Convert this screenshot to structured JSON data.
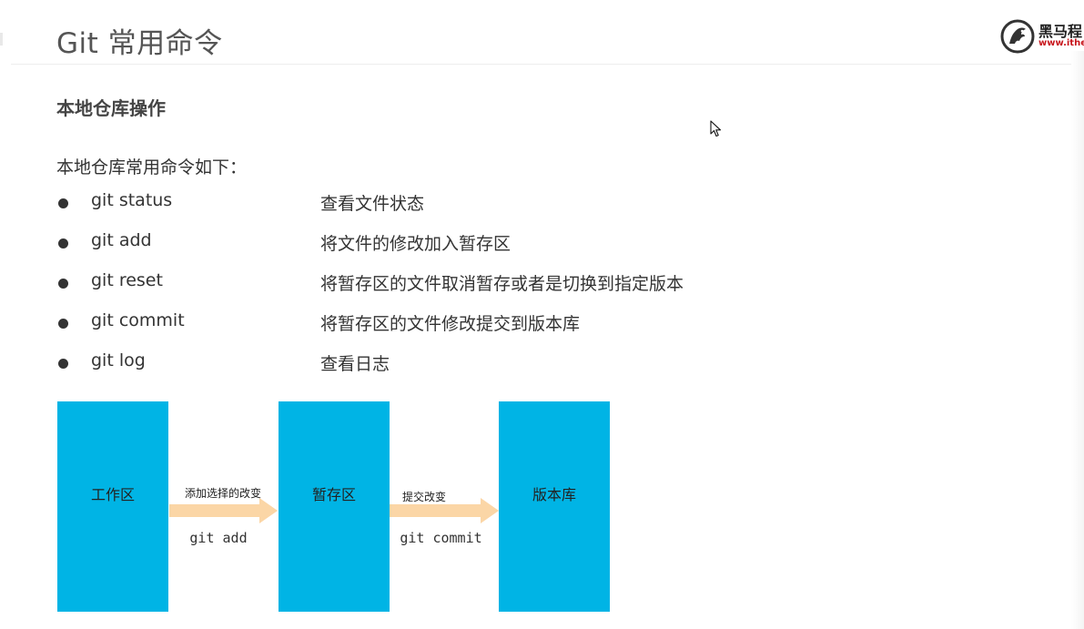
{
  "header": {
    "title": "Git 常用命令",
    "logo": {
      "brand": "黑马程",
      "url": "www.itheim"
    }
  },
  "section": {
    "heading": "本地仓库操作",
    "intro": "本地仓库常用命令如下："
  },
  "commands": [
    {
      "cmd": "git status",
      "desc": "查看文件状态"
    },
    {
      "cmd": "git add",
      "desc": "将文件的修改加入暂存区"
    },
    {
      "cmd": "git reset",
      "desc": "将暂存区的文件取消暂存或者是切换到指定版本"
    },
    {
      "cmd": "git commit",
      "desc": "将暂存区的文件修改提交到版本库"
    },
    {
      "cmd": "git log",
      "desc": "查看日志"
    }
  ],
  "diagram": {
    "stages": [
      {
        "label": "工作区"
      },
      {
        "label": "暂存区"
      },
      {
        "label": "版本库"
      }
    ],
    "transitions": [
      {
        "label": "添加选择的改变",
        "cmd": "git add"
      },
      {
        "label": "提交改变",
        "cmd": "git commit"
      }
    ]
  },
  "colors": {
    "stage_fill": "#00b4e5",
    "arrow_fill": "#fbd6a6",
    "logo_red": "#c8161d"
  }
}
